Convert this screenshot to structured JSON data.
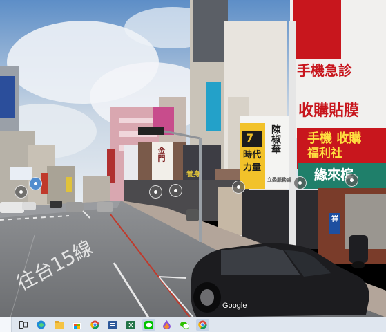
{
  "street_view": {
    "watermark": "Google",
    "road_marking_text": "往台15線",
    "signs": {
      "phone_shop_line1": "手機急診",
      "phone_shop_line2": "收購貼膜",
      "welfare_line1": "手機 收購",
      "welfare_line2": "福利社",
      "green_line": "緣來槟",
      "agency_logo": "7",
      "agency_line1": "時代",
      "agency_line2": "力量",
      "agency_name": "陳椒華",
      "agency_sub": "立委服務處",
      "vertical_sign": "金門",
      "shop_sign": "養身",
      "blue_sign": "祥"
    },
    "pins": [
      "place-pin",
      "place-pin",
      "place-pin",
      "place-pin",
      "place-pin",
      "place-pin"
    ]
  },
  "taskbar": {
    "icons": [
      "task-view-icon",
      "edge-icon",
      "file-explorer-icon",
      "store-icon",
      "chrome-icon",
      "word-icon",
      "excel-icon",
      "line-icon",
      "paint-icon",
      "wechat-icon",
      "chrome-alt-icon"
    ]
  }
}
